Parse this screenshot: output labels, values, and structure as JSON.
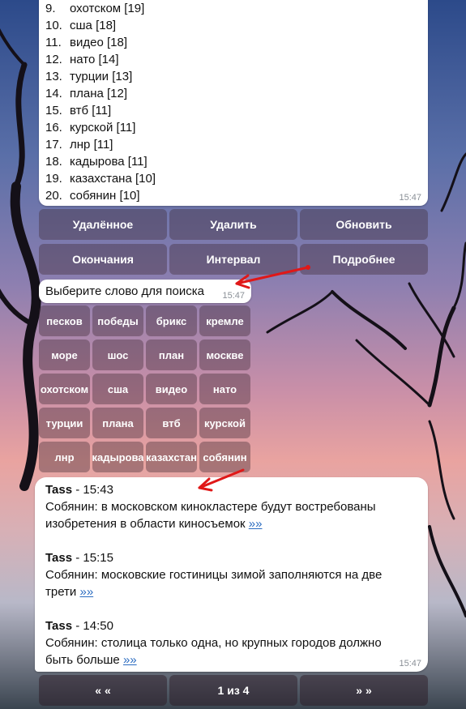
{
  "word_list": {
    "items": [
      {
        "num": "9.",
        "word": "охотском",
        "count": "[19]"
      },
      {
        "num": "10.",
        "word": "сша",
        "count": "[18]"
      },
      {
        "num": "11.",
        "word": "видео",
        "count": "[18]"
      },
      {
        "num": "12.",
        "word": "нато",
        "count": "[14]"
      },
      {
        "num": "13.",
        "word": "турции",
        "count": "[13]"
      },
      {
        "num": "14.",
        "word": "плана",
        "count": "[12]"
      },
      {
        "num": "15.",
        "word": "втб",
        "count": "[11]"
      },
      {
        "num": "16.",
        "word": "курской",
        "count": "[11]"
      },
      {
        "num": "17.",
        "word": "лнр",
        "count": "[11]"
      },
      {
        "num": "18.",
        "word": "кадырова",
        "count": "[11]"
      },
      {
        "num": "19.",
        "word": "казахстана",
        "count": "[10]"
      },
      {
        "num": "20.",
        "word": "собянин",
        "count": "[10]"
      }
    ],
    "time": "15:47"
  },
  "menu_keyboard": {
    "row1": [
      "Удалённое",
      "Удалить",
      "Обновить"
    ],
    "row2": [
      "Окончания",
      "Интервал",
      "Подробнее"
    ]
  },
  "prompt": {
    "text": "Выберите слово для поиска",
    "time": "15:47"
  },
  "word_keyboard": {
    "rows": [
      [
        "песков",
        "победы",
        "брикс",
        "кремле"
      ],
      [
        "море",
        "шос",
        "план",
        "москве"
      ],
      [
        "охотском",
        "сша",
        "видео",
        "нато"
      ],
      [
        "турции",
        "плана",
        "втб",
        "курской"
      ],
      [
        "лнр",
        "кадырова",
        "казахстан",
        "собянин"
      ]
    ]
  },
  "news": {
    "items": [
      {
        "source": "Tass",
        "time": "15:43",
        "line1": "Собянин: в московском кинокластере будут востребованы",
        "line2": "изобретения в области киносъемок",
        "more": "»»"
      },
      {
        "source": "Tass",
        "time": "15:15",
        "line1": "Собянин: московские гостиницы зимой заполняются на две",
        "line2": "трети",
        "more": "»»"
      },
      {
        "source": "Tass",
        "time": "14:50",
        "line1": "Собянин: столица только одна, но крупных городов должно",
        "line2": "быть больше",
        "more": "»»"
      }
    ],
    "time": "15:47"
  },
  "pagination": {
    "prev": "« «",
    "page": "1 из 4",
    "next": "» »"
  }
}
